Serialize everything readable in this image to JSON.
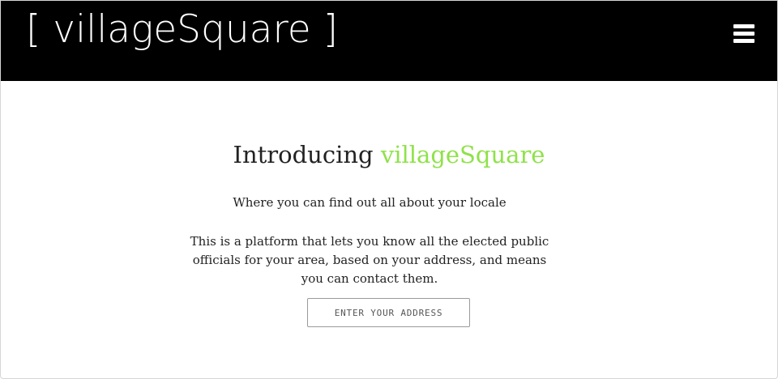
{
  "header": {
    "logo_text": "[ villageSquare ]",
    "menu_icon": "hamburger-menu-icon",
    "background_color": "#000000"
  },
  "main": {
    "headline_prefix": "Introducing ",
    "headline_brand": "villageSquare",
    "brand_color": "#8fe24a",
    "tagline": "Where you can find out all about your locale",
    "description": "This is a platform that lets you know all the elected public officials for your area, based on your address, and means you can contact them.",
    "address_button_label": "ENTER YOUR ADDRESS"
  }
}
